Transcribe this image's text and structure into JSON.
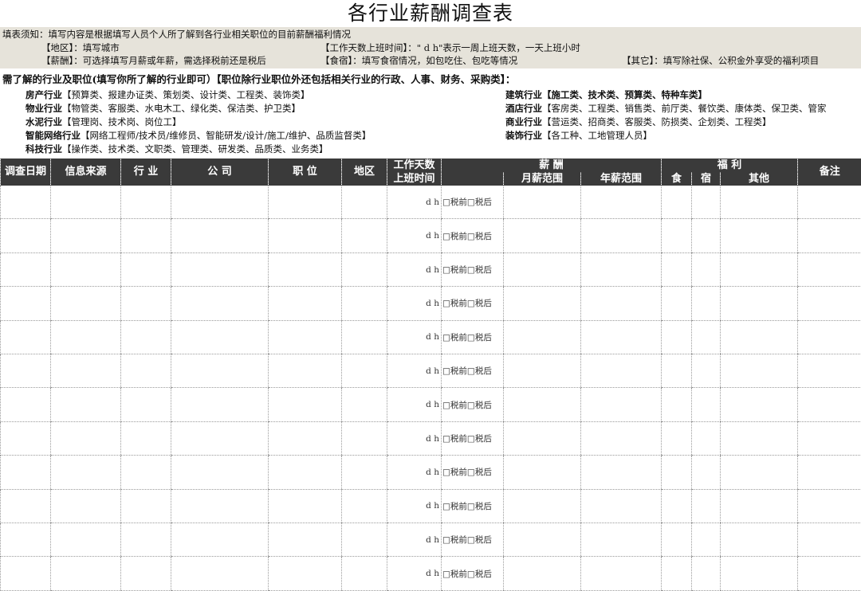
{
  "title": "各行业薪酬调查表",
  "notes": {
    "intro": "填表须知：填写内容是根据填写人员个人所了解到各行业相关职位的目前薪酬福利情况",
    "region": "【地区】：填写城市",
    "workdays": "【工作天数上班时间】：\" d  h\"表示一周上班天数，一天上班小时",
    "salary": "【薪酬】：可选择填写月薪或年薪，需选择税前还是税后",
    "board": "【食宿】：填写食宿情况，如包吃住、包吃等情况",
    "other": "【其它】：填写除社保、公积金外享受的福利项目"
  },
  "industries": {
    "heading": "需了解的行业及职位(填写你所了解的行业即可）【职位除行业职位外还包括相关行业的行政、人事、财务、采购类】：",
    "left": [
      {
        "name": "房产行业",
        "roles": "【预算类、报建办证类、策划类、设计类、工程类、装饰类】"
      },
      {
        "name": "物业行业",
        "roles": "【物管类、客服类、水电木工、绿化类、保洁类、护卫类】"
      },
      {
        "name": "水泥行业",
        "roles": "【管理岗、技术岗、岗位工】"
      },
      {
        "name": "智能网络行业",
        "roles": "【网络工程师/技术员/维修员、智能研发/设计/施工/维护、品质监督类】"
      },
      {
        "name": "科技行业",
        "roles": "【操作类、技术类、文职类、管理类、研发类、品质类、业务类】"
      }
    ],
    "right": [
      {
        "name": "建筑行业",
        "roles": "【施工类、技术类、预算类、特种车类】"
      },
      {
        "name": "酒店行业",
        "roles": "【客房类、工程类、销售类、前厅类、餐饮类、康体类、保卫类、管家"
      },
      {
        "name": "商业行业",
        "roles": "【营运类、招商类、客服类、防损类、企划类、工程类】"
      },
      {
        "name": "装饰行业",
        "roles": "【各工种、工地管理人员】"
      }
    ]
  },
  "table": {
    "headers": {
      "date": "调查日期",
      "source": "信息来源",
      "industry": "行  业",
      "company": "公  司",
      "position": "职  位",
      "region": "地区",
      "workdays": "工作天数",
      "hours": "上班时间",
      "pay": "薪  酬",
      "monthly": "月薪范围",
      "annual": "年薪范围",
      "benefits": "福  利",
      "food": "食",
      "lodging": "宿",
      "other": "其他",
      "remark": "备注"
    },
    "row_workdays": "d    h",
    "row_tax": "□税前□税后",
    "row_count": 12
  }
}
